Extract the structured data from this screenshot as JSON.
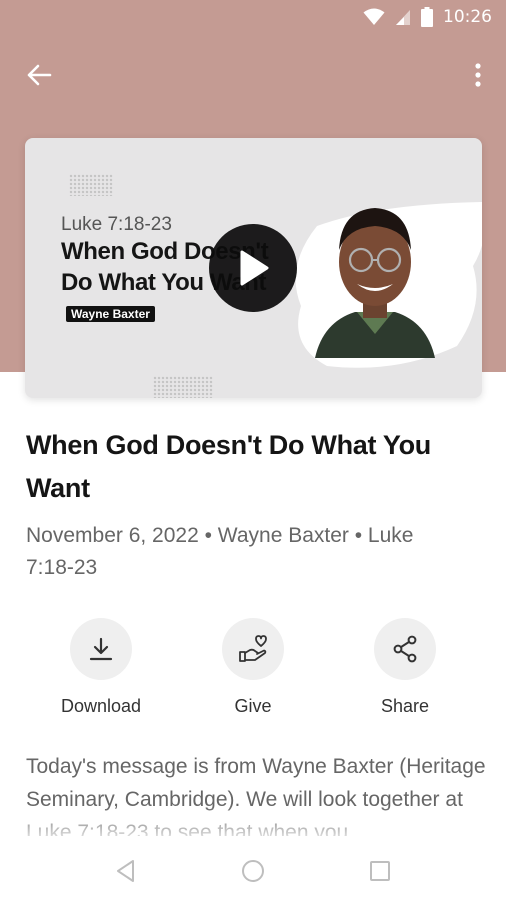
{
  "status_bar": {
    "time": "10:26",
    "icons": [
      "wifi-icon",
      "signal-icon",
      "battery-icon"
    ]
  },
  "app_bar": {
    "back_icon": "arrow-left-icon",
    "menu_icon": "more-vertical-icon"
  },
  "thumbnail": {
    "scripture": "Luke 7:18-23",
    "title_line1": "When God Doesn't",
    "title_line2": "Do What You Want",
    "speaker_tag": "Wayne Baxter",
    "play_icon": "play-icon"
  },
  "sermon": {
    "title": "When God Doesn't Do What You Want",
    "meta": "November 6, 2022 • Wayne Baxter • Luke 7:18-23"
  },
  "actions": [
    {
      "label": "Download",
      "icon": "download-icon"
    },
    {
      "label": "Give",
      "icon": "give-hand-heart-icon"
    },
    {
      "label": "Share",
      "icon": "share-icon"
    }
  ],
  "description": "Today's message is from Wayne Baxter (Heritage Seminary, Cambridge). We will look together at Luke 7:18-23 to see that when you",
  "colors": {
    "header_background": "#c49b93",
    "thumbnail_background": "#e6e5e6",
    "action_circle": "#efefef"
  }
}
